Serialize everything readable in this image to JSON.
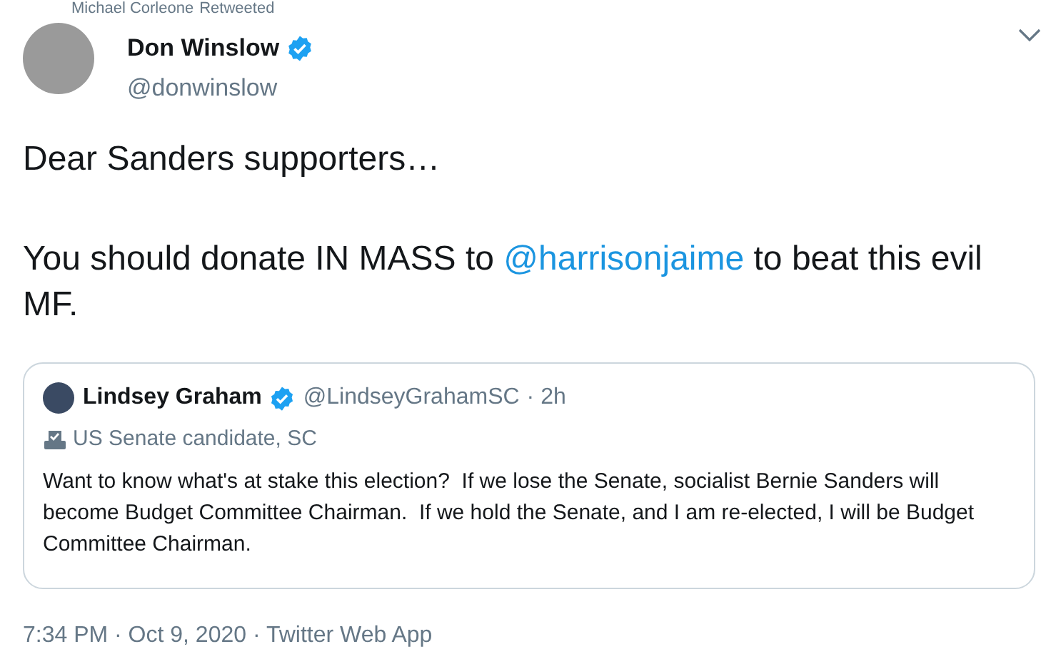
{
  "retweet_bar": {
    "name": "Michael Corleone",
    "label": "Retweeted"
  },
  "author": {
    "name": "Don Winslow",
    "verified": true,
    "handle": "@donwinslow"
  },
  "tweet_text": [
    "Dear Sanders supporters…",
    "You should donate IN MASS to **@harrisonjaime** to beat this evil MF."
  ],
  "quoted_tweet": {
    "name": "Lindsey Graham",
    "verified": true,
    "handle": "@LindseyGrahamSC",
    "time": "· 2h",
    "label": "US Senate candidate, SC",
    "text": "Want to know what's at stake this election?  If we lose the Senate, socialist Bernie Sanders will become Budget Committee Chairman.  If we hold the Senate, and I am re-elected, I will be Budget Committee Chairman."
  },
  "footer": "7:34 PM · Oct 9, 2020 · Twitter Web App"
}
